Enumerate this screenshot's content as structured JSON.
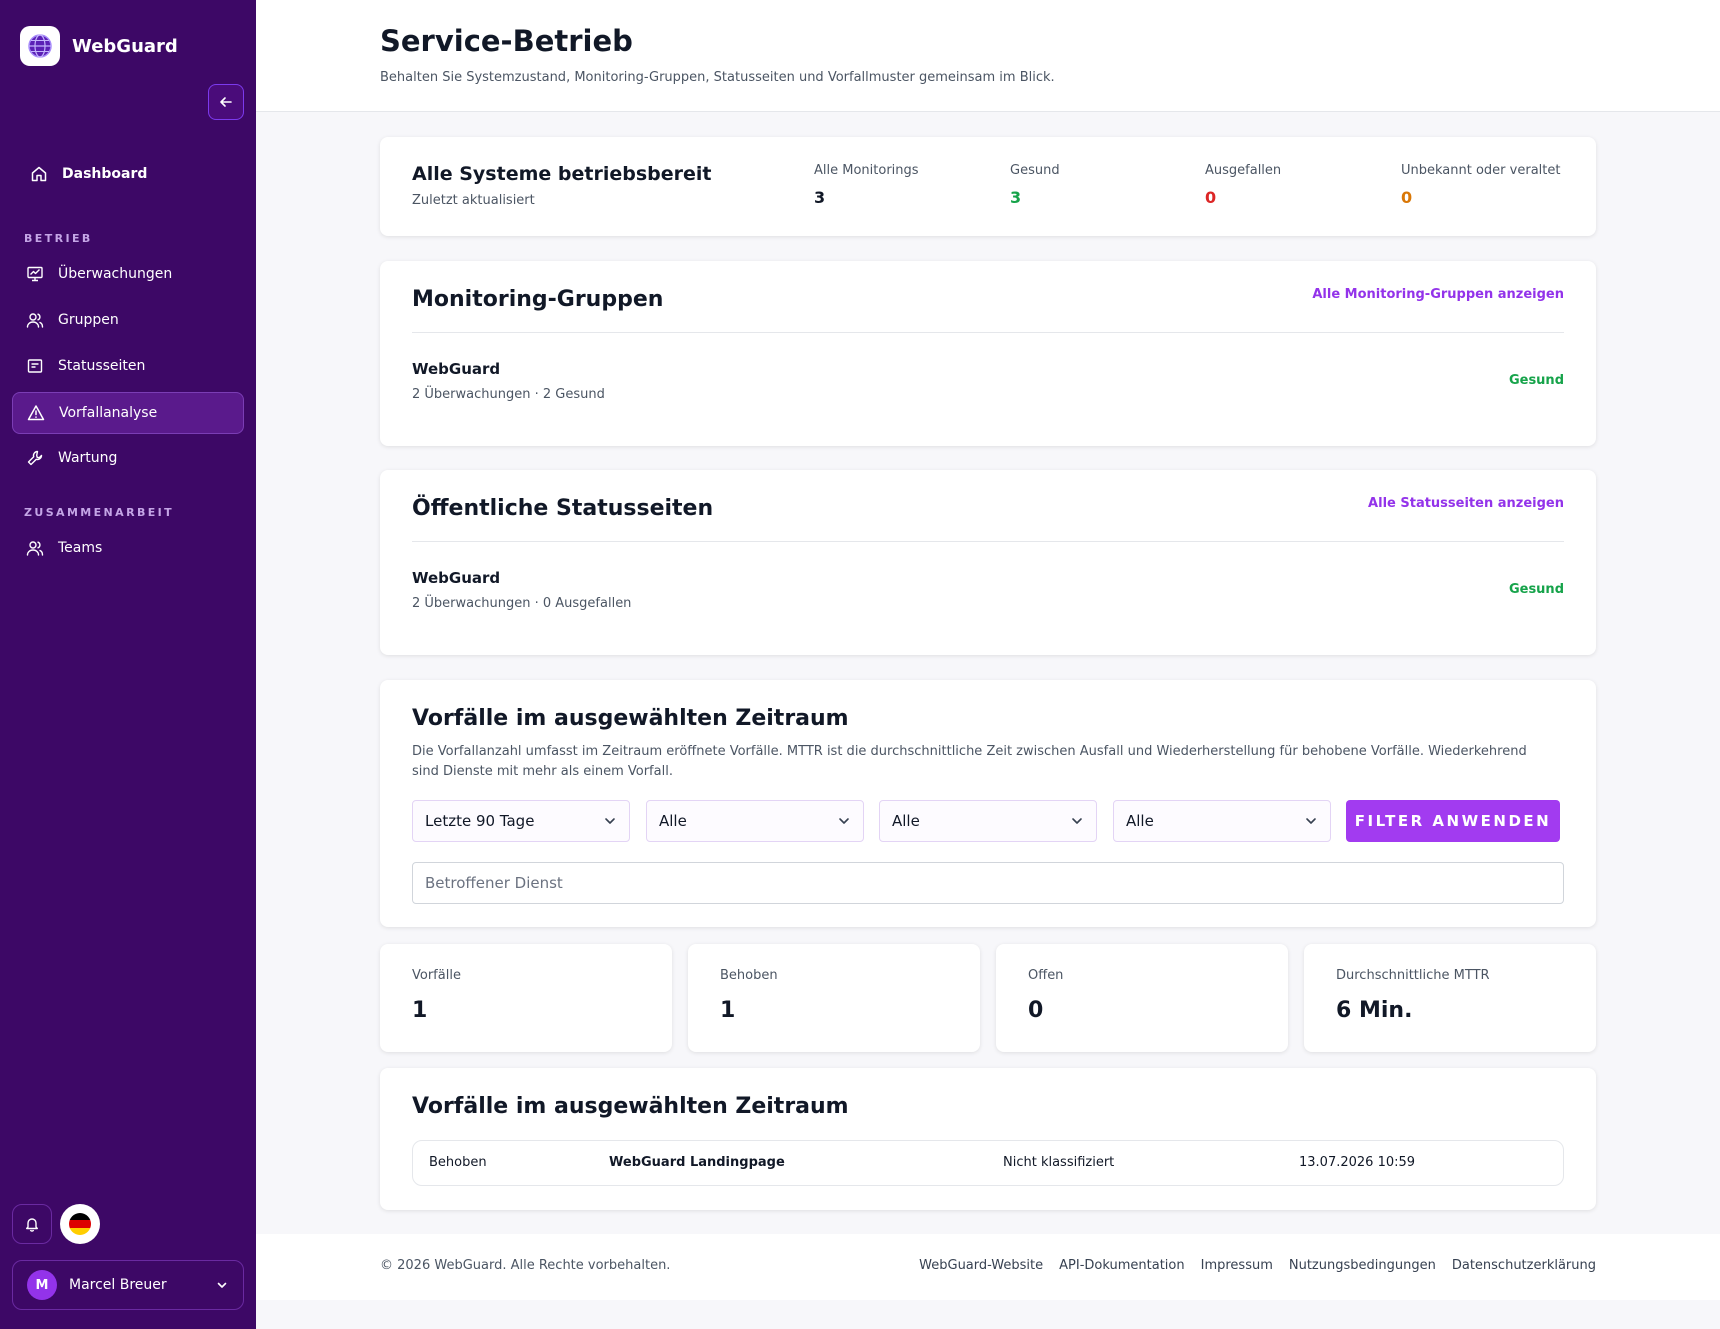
{
  "app": {
    "name": "WebGuard"
  },
  "sidebar": {
    "items": [
      {
        "label": "Dashboard"
      },
      {
        "label": "Überwachungen"
      },
      {
        "label": "Gruppen"
      },
      {
        "label": "Statusseiten"
      },
      {
        "label": "Vorfallanalyse"
      },
      {
        "label": "Wartung"
      },
      {
        "label": "Teams"
      }
    ],
    "sections": [
      "BETRIEB",
      "ZUSAMMENARBEIT"
    ],
    "user": {
      "initial": "M",
      "name": "Marcel Breuer"
    }
  },
  "header": {
    "title": "Service-Betrieb",
    "subtitle": "Behalten Sie Systemzustand, Monitoring-Gruppen, Statusseiten und Vorfallmuster gemeinsam im Blick."
  },
  "summary": {
    "title": "Alle Systeme betriebsbereit",
    "subtitle": "Zuletzt aktualisiert",
    "stats": [
      {
        "label": "Alle Monitorings",
        "value": "3",
        "color": "#111827"
      },
      {
        "label": "Gesund",
        "value": "3",
        "color": "#16a34a"
      },
      {
        "label": "Ausgefallen",
        "value": "0",
        "color": "#dc2626"
      },
      {
        "label": "Unbekannt oder veraltet",
        "value": "0",
        "color": "#d97706"
      }
    ]
  },
  "groups": {
    "title": "Monitoring-Gruppen",
    "link": "Alle Monitoring-Gruppen anzeigen",
    "item": {
      "name": "WebGuard",
      "meta": "2 Überwachungen · 2 Gesund",
      "status": "Gesund"
    }
  },
  "statuspages": {
    "title": "Öffentliche Statusseiten",
    "link": "Alle Statusseiten anzeigen",
    "item": {
      "name": "WebGuard",
      "meta": "2 Überwachungen · 0 Ausgefallen",
      "status": "Gesund"
    }
  },
  "filters": {
    "title": "Vorfälle im ausgewählten Zeitraum",
    "description": "Die Vorfallanzahl umfasst im Zeitraum eröffnete Vorfälle. MTTR ist die durchschnittliche Zeit zwischen Ausfall und Wiederherstellung für behobene Vorfälle. Wiederkehrend sind Dienste mit mehr als einem Vorfall.",
    "selects": [
      "Letzte 90 Tage",
      "Alle",
      "Alle",
      "Alle"
    ],
    "apply_label": "FILTER ANWENDEN",
    "search_placeholder": "Betroffener Dienst"
  },
  "kpis": [
    {
      "label": "Vorfälle",
      "value": "1"
    },
    {
      "label": "Behoben",
      "value": "1"
    },
    {
      "label": "Offen",
      "value": "0"
    },
    {
      "label": "Durchschnittliche MTTR",
      "value": "6 Min."
    }
  ],
  "incidents": {
    "title": "Vorfälle im ausgewählten Zeitraum",
    "rows": [
      {
        "status": "Behoben",
        "service": "WebGuard Landingpage",
        "classification": "Nicht klassifiziert",
        "time": "13.07.2026 10:59"
      }
    ]
  },
  "footer": {
    "copyright": "© 2026 WebGuard. Alle Rechte vorbehalten.",
    "links": [
      "WebGuard-Website",
      "API-Dokumentation",
      "Impressum",
      "Nutzungsbedingungen",
      "Datenschutzerklärung"
    ]
  },
  "colors": {
    "sidebar_bg": "#3d0866",
    "accent": "#9333ea",
    "healthy": "#16a34a",
    "down": "#dc2626",
    "unknown": "#d97706"
  }
}
